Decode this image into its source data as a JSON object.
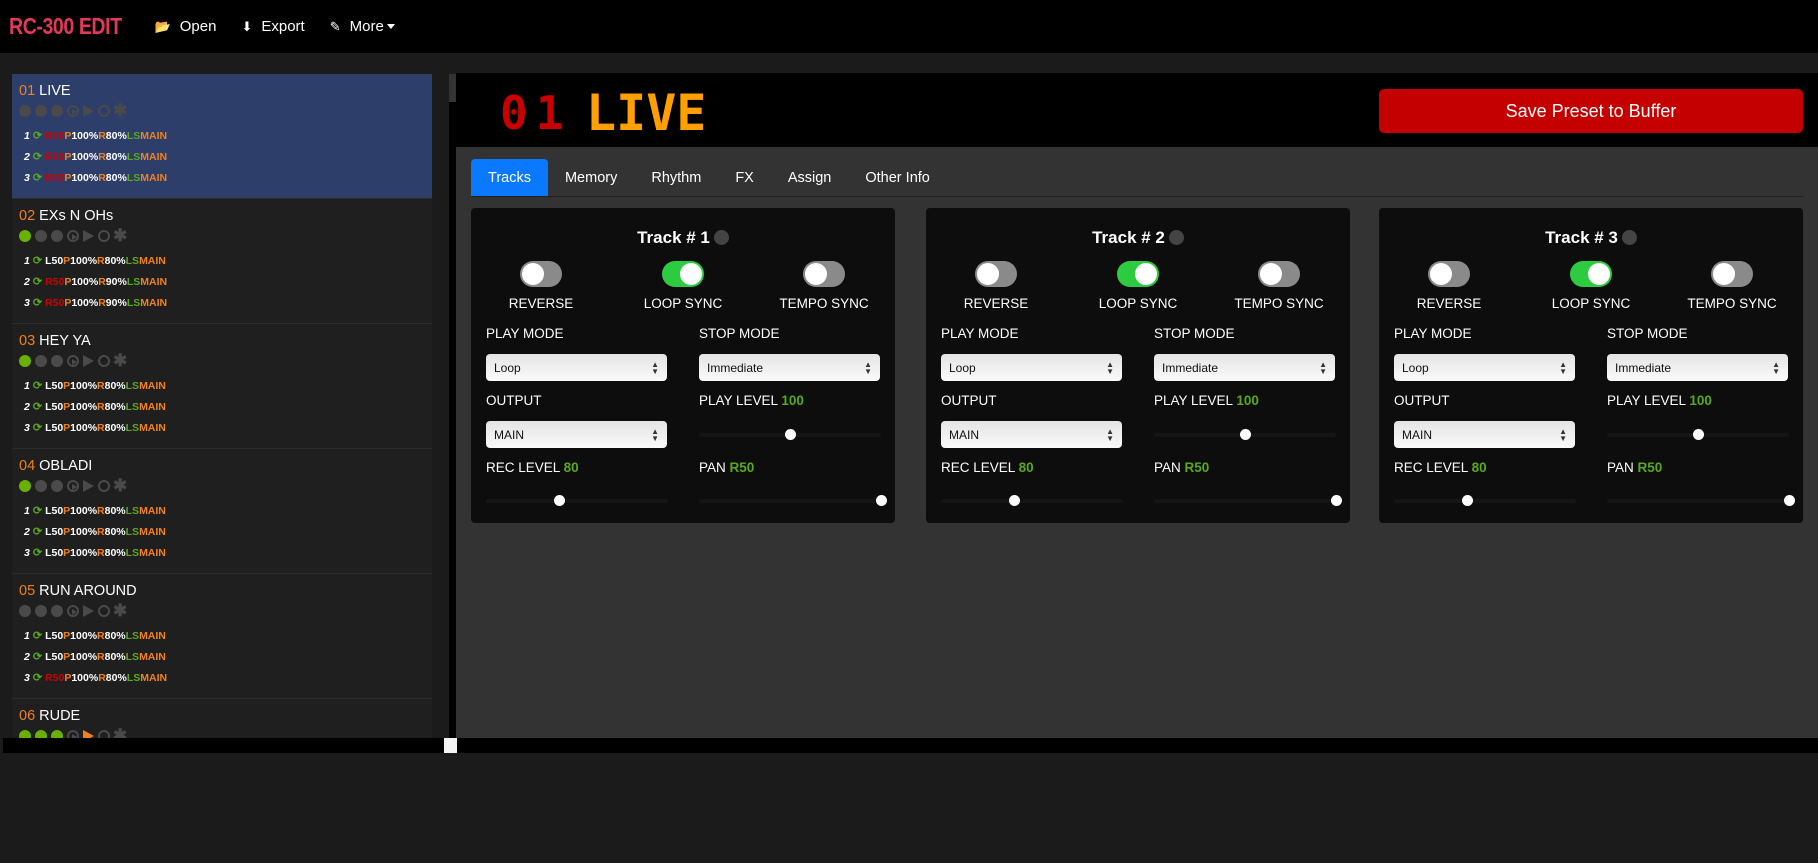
{
  "app": {
    "title": "RC-300 EDIT"
  },
  "nav": [
    {
      "label": "Open",
      "icon": "folder-open-icon"
    },
    {
      "label": "Export",
      "icon": "download-icon"
    },
    {
      "label": "More",
      "icon": "edit-icon",
      "dropdown": true
    }
  ],
  "colors": {
    "accent": "#0a78ff",
    "save": "#c40000",
    "brand": "#e0395a",
    "preset_number": "#f08020",
    "on": "#6ab000",
    "toggle_on": "#2dcc40"
  },
  "sidebar": {
    "presets": [
      {
        "number": "01",
        "name": "LIVE",
        "active": true,
        "status": [
          false,
          false,
          false
        ],
        "playing": false,
        "tracks": [
          {
            "n": "1",
            "pan": "R50",
            "pan_color": "red",
            "p": "100%",
            "r": "80%",
            "ls": "LS",
            "out": "MAIN"
          },
          {
            "n": "2",
            "pan": "R50",
            "pan_color": "red",
            "p": "100%",
            "r": "80%",
            "ls": "LS",
            "out": "MAIN"
          },
          {
            "n": "3",
            "pan": "R50",
            "pan_color": "red",
            "p": "100%",
            "r": "80%",
            "ls": "LS",
            "out": "MAIN"
          }
        ]
      },
      {
        "number": "02",
        "name": "EXs N OHs",
        "active": false,
        "status": [
          true,
          false,
          false
        ],
        "playing": false,
        "tracks": [
          {
            "n": "1",
            "pan": "L50",
            "pan_color": "white",
            "p": "100%",
            "r": "80%",
            "ls": "LS",
            "out": "MAIN"
          },
          {
            "n": "2",
            "pan": "R50",
            "pan_color": "red",
            "p": "100%",
            "r": "90%",
            "ls": "LS",
            "out": "MAIN"
          },
          {
            "n": "3",
            "pan": "R50",
            "pan_color": "red",
            "p": "100%",
            "r": "90%",
            "ls": "LS",
            "out": "MAIN"
          }
        ]
      },
      {
        "number": "03",
        "name": "HEY YA",
        "active": false,
        "status": [
          true,
          false,
          false
        ],
        "playing": false,
        "tracks": [
          {
            "n": "1",
            "pan": "L50",
            "pan_color": "white",
            "p": "100%",
            "r": "80%",
            "ls": "LS",
            "out": "MAIN"
          },
          {
            "n": "2",
            "pan": "L50",
            "pan_color": "white",
            "p": "100%",
            "r": "80%",
            "ls": "LS",
            "out": "MAIN"
          },
          {
            "n": "3",
            "pan": "L50",
            "pan_color": "white",
            "p": "100%",
            "r": "80%",
            "ls": "LS",
            "out": "MAIN"
          }
        ]
      },
      {
        "number": "04",
        "name": "OBLADI",
        "active": false,
        "status": [
          true,
          false,
          false
        ],
        "playing": false,
        "tracks": [
          {
            "n": "1",
            "pan": "L50",
            "pan_color": "white",
            "p": "100%",
            "r": "80%",
            "ls": "LS",
            "out": "MAIN"
          },
          {
            "n": "2",
            "pan": "L50",
            "pan_color": "white",
            "p": "100%",
            "r": "80%",
            "ls": "LS",
            "out": "MAIN"
          },
          {
            "n": "3",
            "pan": "L50",
            "pan_color": "white",
            "p": "100%",
            "r": "80%",
            "ls": "LS",
            "out": "MAIN"
          }
        ]
      },
      {
        "number": "05",
        "name": "RUN AROUND",
        "active": false,
        "status": [
          false,
          false,
          false
        ],
        "playing": false,
        "tracks": [
          {
            "n": "1",
            "pan": "L50",
            "pan_color": "white",
            "p": "100%",
            "r": "80%",
            "ls": "LS",
            "out": "MAIN"
          },
          {
            "n": "2",
            "pan": "L50",
            "pan_color": "white",
            "p": "100%",
            "r": "80%",
            "ls": "LS",
            "out": "MAIN"
          },
          {
            "n": "3",
            "pan": "R50",
            "pan_color": "red",
            "p": "100%",
            "r": "80%",
            "ls": "LS",
            "out": "MAIN"
          }
        ]
      },
      {
        "number": "06",
        "name": "RUDE",
        "active": false,
        "status": [
          true,
          true,
          true
        ],
        "playing": true,
        "tracks": []
      }
    ],
    "labels": {
      "p": "P",
      "r": "R"
    }
  },
  "header": {
    "preset_number": "01",
    "preset_name": "LIVE",
    "save_label": "Save Preset to Buffer"
  },
  "tabs": [
    {
      "label": "Tracks",
      "active": true
    },
    {
      "label": "Memory"
    },
    {
      "label": "Rhythm"
    },
    {
      "label": "FX"
    },
    {
      "label": "Assign"
    },
    {
      "label": "Other Info"
    }
  ],
  "track_labels": {
    "reverse": "REVERSE",
    "loop_sync": "LOOP SYNC",
    "tempo_sync": "TEMPO SYNC",
    "play_mode": "PLAY MODE",
    "stop_mode": "STOP MODE",
    "output": "OUTPUT",
    "play_level": "PLAY LEVEL",
    "rec_level": "REC LEVEL",
    "pan": "PAN"
  },
  "tracks": [
    {
      "title": "Track # 1",
      "reverse": false,
      "loop_sync": true,
      "tempo_sync": false,
      "play_mode": "Loop",
      "stop_mode": "Immediate",
      "output": "MAIN",
      "play_level": "100",
      "play_level_fraction": 0.5,
      "rec_level": "80",
      "rec_level_fraction": 0.4,
      "pan": "R50",
      "pan_fraction": 1.0
    },
    {
      "title": "Track # 2",
      "reverse": false,
      "loop_sync": true,
      "tempo_sync": false,
      "play_mode": "Loop",
      "stop_mode": "Immediate",
      "output": "MAIN",
      "play_level": "100",
      "play_level_fraction": 0.5,
      "rec_level": "80",
      "rec_level_fraction": 0.4,
      "pan": "R50",
      "pan_fraction": 1.0
    },
    {
      "title": "Track # 3",
      "reverse": false,
      "loop_sync": true,
      "tempo_sync": false,
      "play_mode": "Loop",
      "stop_mode": "Immediate",
      "output": "MAIN",
      "play_level": "100",
      "play_level_fraction": 0.5,
      "rec_level": "80",
      "rec_level_fraction": 0.4,
      "pan": "R50",
      "pan_fraction": 1.0
    }
  ]
}
